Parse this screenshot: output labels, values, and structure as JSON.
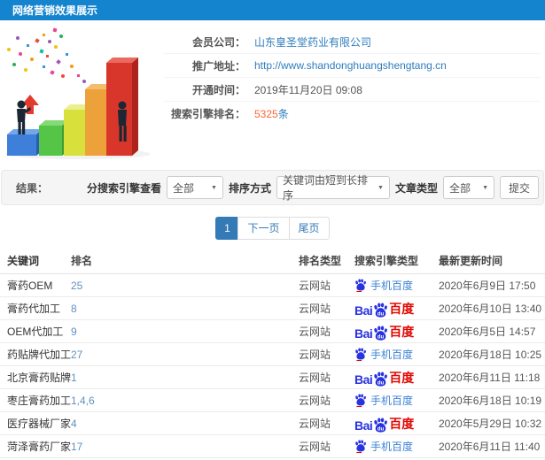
{
  "header": {
    "title": "网络营销效果展示"
  },
  "info": {
    "fields": [
      {
        "label": "会员公司：",
        "value": "山东皇圣堂药业有限公司"
      },
      {
        "label": "推广地址：",
        "value": "http://www.shandonghuangshengtang.cn"
      },
      {
        "label": "开通时间：",
        "value": "2019年11月20日 09:08"
      },
      {
        "label": "搜索引擎排名：",
        "value": "5325",
        "suffix": "条"
      }
    ]
  },
  "filters": {
    "result_label": "结果：",
    "engine": {
      "label": "分搜索引擎查看",
      "value": "全部"
    },
    "sort": {
      "label": "排序方式",
      "value": "关键词由短到长排序"
    },
    "article": {
      "label": "文章类型",
      "value": "全部"
    },
    "submit": "提交"
  },
  "pagination": {
    "pages": [
      "1"
    ],
    "next": "下一页",
    "last": "尾页"
  },
  "table": {
    "headers": [
      "关键词",
      "排名",
      "排名类型",
      "搜索引擎类型",
      "最新更新时间"
    ],
    "rows": [
      {
        "keyword": "膏药OEM",
        "rank": "25",
        "rank_type": "云网站",
        "engine": "mobile-baidu",
        "updated": "2020年6月9日 17:50"
      },
      {
        "keyword": "膏药代加工",
        "rank": "8",
        "rank_type": "云网站",
        "engine": "baidu",
        "updated": "2020年6月10日 13:40"
      },
      {
        "keyword": "OEM代加工",
        "rank": "9",
        "rank_type": "云网站",
        "engine": "baidu",
        "updated": "2020年6月5日 14:57"
      },
      {
        "keyword": "药贴牌代加工",
        "rank": "27",
        "rank_type": "云网站",
        "engine": "mobile-baidu",
        "updated": "2020年6月18日 10:25"
      },
      {
        "keyword": "北京膏药贴牌",
        "rank": "1",
        "rank_type": "云网站",
        "engine": "baidu",
        "updated": "2020年6月11日 11:18"
      },
      {
        "keyword": "枣庄膏药加工",
        "rank": "1,4,6",
        "rank_type": "云网站",
        "engine": "mobile-baidu",
        "updated": "2020年6月18日 10:19"
      },
      {
        "keyword": "医疗器械厂家",
        "rank": "4",
        "rank_type": "云网站",
        "engine": "baidu",
        "updated": "2020年5月29日 10:32"
      },
      {
        "keyword": "菏泽膏药厂家",
        "rank": "17",
        "rank_type": "云网站",
        "engine": "mobile-baidu",
        "updated": "2020年6月11日 11:40"
      }
    ]
  },
  "engine_logos": {
    "mobile_baidu_label": "手机百度",
    "baidu_bai": "Bai",
    "baidu_du": "du",
    "baidu_cn": "百度"
  },
  "colors": {
    "header_bg": "#1484cf",
    "link_blue": "#2e7cbd",
    "highlight_orange": "#ff6633",
    "rank_link": "#6090c0",
    "pagination_blue": "#337ab7",
    "baidu_blue": "#2932e1",
    "baidu_red": "#e10601",
    "mobile_baidu_blue": "#3e83d6"
  }
}
